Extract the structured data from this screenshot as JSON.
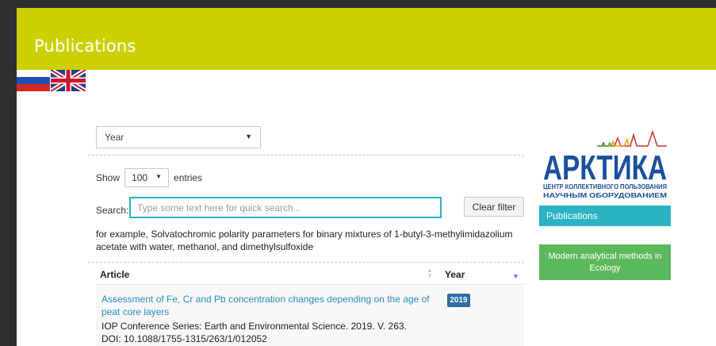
{
  "header": {
    "title": "Publications"
  },
  "languages": [
    {
      "name": "Russian",
      "icon": "flag-ru-icon"
    },
    {
      "name": "English",
      "icon": "flag-uk-icon"
    }
  ],
  "filter": {
    "year_select": "Year"
  },
  "table_controls": {
    "show_label": "Show",
    "entries_value": "100",
    "entries_label": "entries",
    "search_label": "Search:",
    "search_placeholder": "Type some text here for quick search...",
    "clear_button": "Clear filter"
  },
  "example_text": "for example, Solvatochromic polarity parameters for binary mixtures of 1-butyl-3-methylimidazolium acetate with water, methanol, and dimethylsulfoxide",
  "table": {
    "columns": [
      "Article",
      "Year"
    ],
    "rows": [
      {
        "title": "Assessment of Fe, Cr and Pb concentration changes depending on the age of peat core layers",
        "journal": "IOP Conference Series: Earth and Environmental Science. 2019. V. 263.",
        "doi": "DOI: 10.1088/1755-1315/263/1/012052",
        "year": "2019"
      }
    ]
  },
  "sidebar": {
    "logo_title": "АРКТИКА",
    "logo_line1": "ЦЕНТР КОЛЛЕКТИВНОГО ПОЛЬЗОВАНИЯ",
    "logo_line2": "НАУЧНЫМ ОБОРУДОВАНИЕМ",
    "publications_button": "Publications",
    "modern_methods_button": "Modern analytical methods in Ecology"
  },
  "colors": {
    "header_bg": "#cdd000",
    "accent_teal": "#2ab3c3",
    "green_button": "#5cb85c",
    "link": "#2a8fbd",
    "logo_blue": "#1a4f9c"
  }
}
